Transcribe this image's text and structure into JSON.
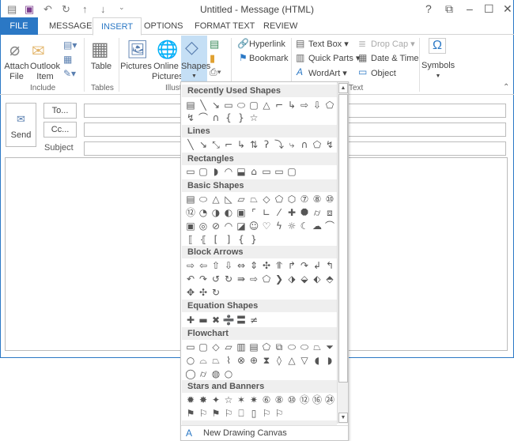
{
  "window": {
    "title": "Untitled - Message (HTML)",
    "controls": [
      "?",
      "⧉",
      "–",
      "☐",
      "✕"
    ]
  },
  "quick_access": [
    "▤",
    "💾",
    "↶",
    "↻",
    "↑",
    "↓",
    "⌄"
  ],
  "tabs": [
    {
      "label": "FILE"
    },
    {
      "label": "MESSAGE"
    },
    {
      "label": "INSERT",
      "active": true
    },
    {
      "label": "OPTIONS"
    },
    {
      "label": "FORMAT TEXT"
    },
    {
      "label": "REVIEW"
    }
  ],
  "ribbon": {
    "include": {
      "label": "Include",
      "attach_file": "Attach File",
      "outlook_item": "Outlook Item"
    },
    "tables": {
      "label": "Tables",
      "table": "Table"
    },
    "illustrations": {
      "label": "Illustrat",
      "pictures": "Pictures",
      "online_pictures": "Online Pictures",
      "shapes": "Shapes"
    },
    "links": {
      "hyperlink": "Hyperlink",
      "bookmark": "Bookmark"
    },
    "text": {
      "label": "Text",
      "text_box": "Text Box",
      "quick_parts": "Quick Parts",
      "wordart": "WordArt",
      "drop_cap": "Drop Cap",
      "date_time": "Date & Time",
      "object": "Object"
    },
    "symbols": {
      "symbols": "Symbols"
    }
  },
  "message": {
    "send": "Send",
    "to": "To...",
    "cc": "Cc...",
    "subject_label": "Subject",
    "to_value": "",
    "cc_value": "",
    "subject_value": ""
  },
  "shapes_menu": {
    "sections": [
      {
        "title": "Recently Used Shapes",
        "rows": [
          [
            "▤",
            "╲",
            "↘",
            "▭",
            "⬭",
            "▢",
            "△",
            "⌐",
            "↳",
            "⇨",
            "⇩",
            "⬠"
          ],
          [
            "↯",
            "⌒",
            "∩",
            "{",
            "}",
            "☆"
          ]
        ]
      },
      {
        "title": "Lines",
        "rows": [
          [
            "╲",
            "↘",
            "⤡",
            "⌐",
            "↳",
            "⇅",
            "ʔ",
            "⤵",
            "⤷",
            "∩",
            "⬠",
            "↯"
          ]
        ]
      },
      {
        "title": "Rectangles",
        "rows": [
          [
            "▭",
            "▢",
            "◗",
            "◠",
            "⬓",
            "⌂",
            "▭",
            "▭",
            "▢"
          ]
        ]
      },
      {
        "title": "Basic Shapes",
        "rows": [
          [
            "▤",
            "⬭",
            "△",
            "◺",
            "▱",
            "⏢",
            "◇",
            "⬠",
            "⬡",
            "⑦",
            "⑧",
            "⑩"
          ],
          [
            "⑫",
            "◔",
            "◑",
            "◐",
            "▣",
            "⌜",
            "∟",
            "⁄",
            "✚",
            "⯃",
            "⌭",
            "⧈"
          ],
          [
            "▣",
            "◎",
            "⊘",
            "◠",
            "◪",
            "☺",
            "♡",
            "ϟ",
            "☼",
            "☾",
            "☁",
            "⌒"
          ],
          [
            "⟦",
            "⦃",
            "[",
            "]",
            "{",
            "}"
          ]
        ]
      },
      {
        "title": "Block Arrows",
        "rows": [
          [
            "⇨",
            "⇦",
            "⇧",
            "⇩",
            "⇔",
            "⇕",
            "✣",
            "⥣",
            "↱",
            "↷",
            "↲",
            "↰"
          ],
          [
            "↶",
            "↷",
            "↺",
            "↻",
            "⇛",
            "⇨",
            "⬠",
            "❯",
            "⬗",
            "⬙",
            "⬖",
            "⬘"
          ],
          [
            "✥",
            "✣",
            "↻"
          ]
        ]
      },
      {
        "title": "Equation Shapes",
        "rows": [
          [
            "✚",
            "▬",
            "✖",
            "➗",
            "〓",
            "≠"
          ]
        ]
      },
      {
        "title": "Flowchart",
        "rows": [
          [
            "▭",
            "▢",
            "◇",
            "▱",
            "▥",
            "▤",
            "⬠",
            "⧉",
            "⬭",
            "⬭",
            "⏢",
            "⏷"
          ],
          [
            "○",
            "⌓",
            "⏢",
            "⌇",
            "⊗",
            "⊕",
            "⧗",
            "◊",
            "△",
            "▽",
            "◖",
            "◗"
          ],
          [
            "◯",
            "⌭",
            "◍",
            "○"
          ]
        ]
      },
      {
        "title": "Stars and Banners",
        "rows": [
          [
            "✹",
            "✸",
            "✦",
            "☆",
            "✶",
            "✷",
            "⑥",
            "⑧",
            "⑩",
            "⑫",
            "⑯",
            "㉔",
            "㉜"
          ],
          [
            "⚑",
            "⚐",
            "⚑",
            "⚐",
            "⎕",
            "▯",
            "⚐",
            "⚐"
          ]
        ]
      }
    ],
    "footer": "New Drawing Canvas"
  },
  "colors": {
    "accent": "#2b78c5",
    "selected_button": "#c5dff5"
  }
}
